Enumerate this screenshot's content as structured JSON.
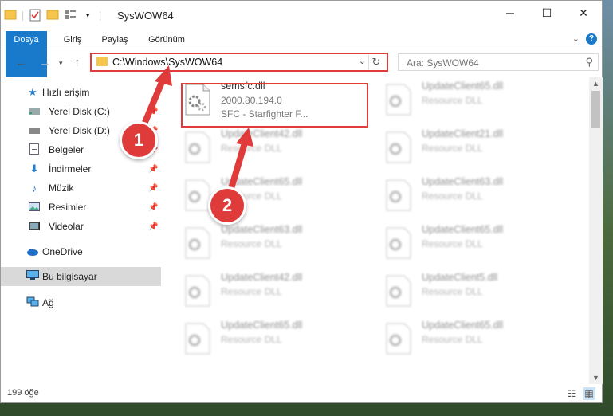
{
  "window": {
    "title": "SysWOW64",
    "controls": {
      "minimize": "─",
      "maximize": "☐",
      "close": "✕"
    }
  },
  "ribbon": {
    "tabs": [
      "Dosya",
      "Giriş",
      "Paylaş",
      "Görünüm"
    ],
    "help": "?"
  },
  "address": {
    "path": "C:\\Windows\\SysWOW64",
    "search_placeholder": "Ara: SysWOW64"
  },
  "sidebar": {
    "items": [
      {
        "label": "Hızlı erişim",
        "icon": "star-icon"
      },
      {
        "label": "Yerel Disk (C:)",
        "icon": "drive-icon"
      },
      {
        "label": "Yerel Disk (D:)",
        "icon": "drive-icon"
      },
      {
        "label": "Belgeler",
        "icon": "document-icon"
      },
      {
        "label": "İndirmeler",
        "icon": "download-icon"
      },
      {
        "label": "Müzik",
        "icon": "music-icon"
      },
      {
        "label": "Resimler",
        "icon": "pictures-icon"
      },
      {
        "label": "Videolar",
        "icon": "video-icon"
      },
      {
        "label": "OneDrive",
        "icon": "cloud-icon"
      },
      {
        "label": "Bu bilgisayar",
        "icon": "computer-icon"
      },
      {
        "label": "Ağ",
        "icon": "network-icon"
      }
    ]
  },
  "files": [
    {
      "name": "semsfc.dll",
      "line1": "2000.80.194.0",
      "line2": "SFC - Starfighter F..."
    },
    {
      "name": "UpdateClient65.dll",
      "line1": "Resource DLL"
    },
    {
      "name": "UpdateClient42.dll",
      "line1": "Resource DLL"
    },
    {
      "name": "UpdateClient21.dll",
      "line1": "Resource DLL"
    },
    {
      "name": "UpdateClient65.dll",
      "line1": "Resource DLL"
    },
    {
      "name": "UpdateClient63.dll",
      "line1": "Resource DLL"
    },
    {
      "name": "UpdateClient63.dll",
      "line1": "Resource DLL"
    },
    {
      "name": "UpdateClient65.dll",
      "line1": "Resource DLL"
    },
    {
      "name": "UpdateClient42.dll",
      "line1": "Resource DLL"
    },
    {
      "name": "UpdateClient5.dll",
      "line1": "Resource DLL"
    },
    {
      "name": "UpdateClient65.dll",
      "line1": "Resource DLL"
    },
    {
      "name": "UpdateClient65.dll",
      "line1": "Resource DLL"
    }
  ],
  "annotations": {
    "step1": "1",
    "step2": "2"
  },
  "status": {
    "count": "199 öğe"
  },
  "colors": {
    "accent": "#1979ca",
    "highlight": "#e23b3b",
    "folder": "#f6c64c"
  }
}
